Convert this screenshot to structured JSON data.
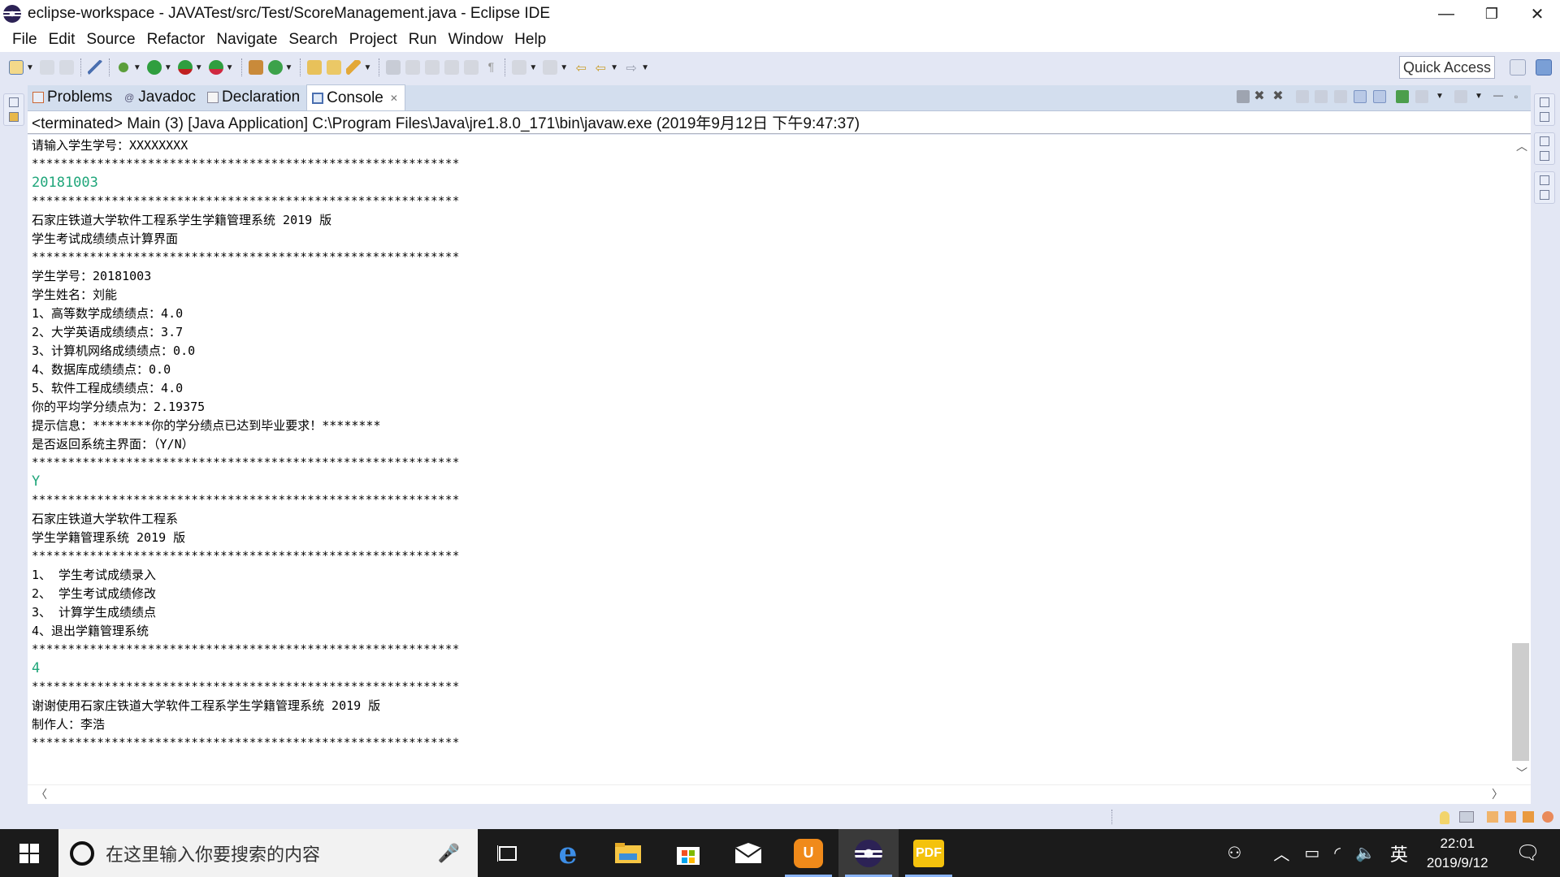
{
  "window": {
    "title": "eclipse-workspace - JAVATest/src/Test/ScoreManagement.java - Eclipse IDE",
    "controls": {
      "minimize": "—",
      "restore": "❐",
      "close": "✕"
    }
  },
  "menu": [
    "File",
    "Edit",
    "Source",
    "Refactor",
    "Navigate",
    "Search",
    "Project",
    "Run",
    "Window",
    "Help"
  ],
  "toolbar": {
    "quick_access": "Quick Access",
    "icons": [
      "new-icon",
      "save-icon",
      "save-all-icon",
      "skip-breakpoints-icon",
      "debug-icon",
      "run-icon",
      "coverage-icon",
      "external-tools-icon",
      "new-java-package-icon",
      "new-java-class-icon",
      "open-type-icon",
      "open-task-icon",
      "search-icon",
      "toggle-mark-occurrences-icon",
      "toggle-block-select-icon",
      "show-whitespace-icon",
      "next-annotation-icon",
      "prev-annotation-icon",
      "last-edit-location-icon",
      "back-icon",
      "forward-icon"
    ]
  },
  "tabs": [
    {
      "label": "Problems",
      "icon": "problems-icon",
      "active": false
    },
    {
      "label": "Javadoc",
      "icon": "javadoc-icon",
      "active": false
    },
    {
      "label": "Declaration",
      "icon": "declaration-icon",
      "active": false
    },
    {
      "label": "Console",
      "icon": "console-icon",
      "active": true,
      "close": "✕"
    }
  ],
  "console": {
    "status": "<terminated> Main (3) [Java Application] C:\\Program Files\\Java\\jre1.8.0_171\\bin\\javaw.exe (2019年9月12日 下午9:47:37)",
    "lines": [
      {
        "text": "请输入学生学号：XXXXXXXX",
        "type": "out"
      },
      {
        "text": "***********************************************************",
        "type": "stars"
      },
      {
        "text": "20181003",
        "type": "input"
      },
      {
        "text": "***********************************************************",
        "type": "stars"
      },
      {
        "text": "石家庄铁道大学软件工程系学生学籍管理系统 2019 版",
        "type": "out"
      },
      {
        "text": "学生考试成绩绩点计算界面",
        "type": "out"
      },
      {
        "text": "***********************************************************",
        "type": "stars"
      },
      {
        "text": "学生学号：20181003",
        "type": "out"
      },
      {
        "text": "学生姓名：刘能",
        "type": "out"
      },
      {
        "text": "1、高等数学成绩绩点：4.0",
        "type": "out"
      },
      {
        "text": "2、大学英语成绩绩点：3.7",
        "type": "out"
      },
      {
        "text": "3、计算机网络成绩绩点：0.0",
        "type": "out"
      },
      {
        "text": "4、数据库成绩绩点：0.0",
        "type": "out"
      },
      {
        "text": "5、软件工程成绩绩点：4.0",
        "type": "out"
      },
      {
        "text": "你的平均学分绩点为：2.19375",
        "type": "out"
      },
      {
        "text": "提示信息：********你的学分绩点已达到毕业要求！********",
        "type": "out"
      },
      {
        "text": "是否返回系统主界面：（Y/N）",
        "type": "out"
      },
      {
        "text": "***********************************************************",
        "type": "stars"
      },
      {
        "text": "Y",
        "type": "input"
      },
      {
        "text": "***********************************************************",
        "type": "stars"
      },
      {
        "text": "石家庄铁道大学软件工程系",
        "type": "out"
      },
      {
        "text": "学生学籍管理系统 2019 版",
        "type": "out"
      },
      {
        "text": "***********************************************************",
        "type": "stars"
      },
      {
        "text": "1、 学生考试成绩录入",
        "type": "out"
      },
      {
        "text": "2、 学生考试成绩修改",
        "type": "out"
      },
      {
        "text": "3、 计算学生成绩绩点",
        "type": "out"
      },
      {
        "text": "4、退出学籍管理系统",
        "type": "out"
      },
      {
        "text": "***********************************************************",
        "type": "stars"
      },
      {
        "text": "4",
        "type": "input"
      },
      {
        "text": "***********************************************************",
        "type": "stars"
      },
      {
        "text": "谢谢使用石家庄铁道大学软件工程系学生学籍管理系统 2019 版",
        "type": "out"
      },
      {
        "text": "制作人：李浩",
        "type": "out"
      },
      {
        "text": "***********************************************************",
        "type": "stars"
      }
    ],
    "input_color": "#1fa67a"
  },
  "taskbar": {
    "search_placeholder": "在这里输入你要搜索的内容",
    "apps": [
      "task-view",
      "edge",
      "file-explorer",
      "store",
      "mail",
      "uc-browser",
      "eclipse",
      "pdf-reader"
    ],
    "tray": {
      "ime": "英",
      "time": "22:01",
      "date": "2019/9/12"
    }
  }
}
